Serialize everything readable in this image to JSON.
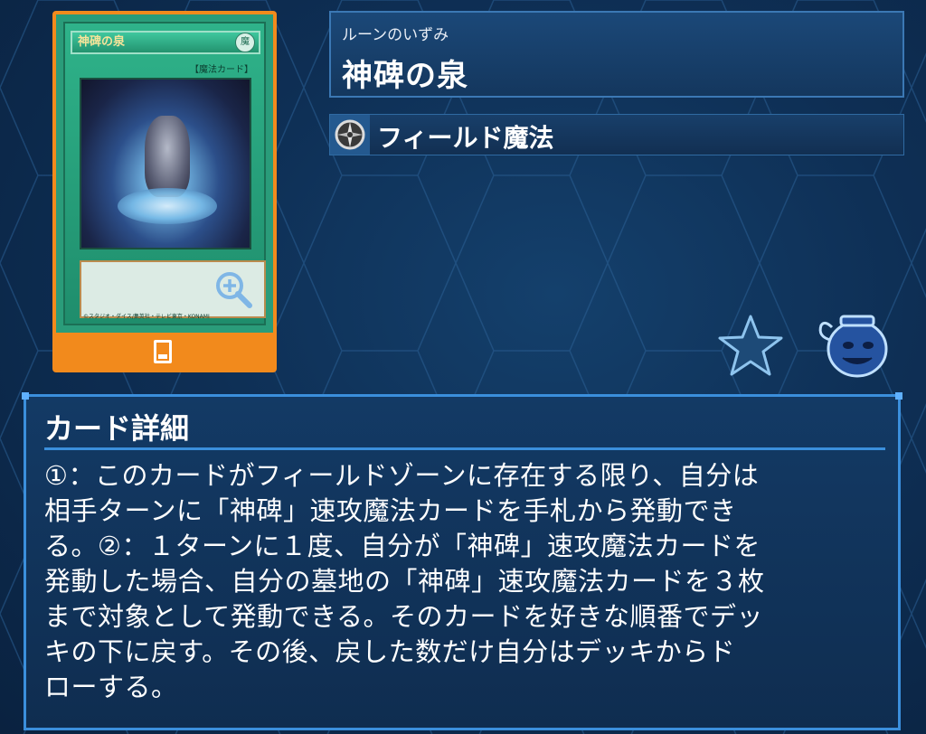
{
  "card": {
    "art_name": "神碑の泉",
    "art_type_line": "【魔法カード】",
    "attribute_label": "魔",
    "copyright": "©スタジオ・ダイス/集英社・テレビ東京・KONAMI"
  },
  "header": {
    "ruby": "ルーンのいずみ",
    "name": "神碑の泉",
    "type_label": "フィールド魔法"
  },
  "icons": {
    "card_view": "card-icon",
    "field_spell": "compass-icon",
    "favorite": "star-icon",
    "pot": "pot-icon",
    "zoom": "zoom-in-icon"
  },
  "details": {
    "title": "カード詳細",
    "text": "①：このカードがフィールドゾーンに存在する限り、自分は\n相手ターンに「神碑」速攻魔法カードを手札から発動でき\nる。②：１ターンに１度、自分が「神碑」速攻魔法カードを\n発動した場合、自分の墓地の「神碑」速攻魔法カードを３枚\nまで対象として発動できる。そのカードを好きな順番でデッ\nキの下に戻す。その後、戻した数だけ自分はデッキからド\nローする。"
  },
  "colors": {
    "accent_orange": "#f28a1c",
    "panel_border": "#3b8fdc",
    "spell_green": "#2fb38a"
  }
}
